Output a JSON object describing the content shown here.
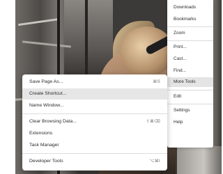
{
  "main_menu": {
    "items": [
      {
        "label": "Downloads"
      },
      {
        "label": "Bookmarks"
      },
      {
        "label": "Zoom"
      },
      {
        "label": "Print..."
      },
      {
        "label": "Cast..."
      },
      {
        "label": "Find..."
      },
      {
        "label": "More Tools"
      },
      {
        "label": "Edit"
      },
      {
        "label": "Settings"
      },
      {
        "label": "Help"
      }
    ]
  },
  "more_tools_menu": {
    "items": [
      {
        "label": "Save Page As...",
        "shortcut": "⌘S"
      },
      {
        "label": "Create Shortcut..."
      },
      {
        "label": "Name Window..."
      },
      {
        "label": "Clear Browsing Data...",
        "shortcut": "⇧⌘⌫"
      },
      {
        "label": "Extensions"
      },
      {
        "label": "Task Manager"
      },
      {
        "label": "Developer Tools",
        "shortcut": "⌥⌘I"
      }
    ]
  }
}
